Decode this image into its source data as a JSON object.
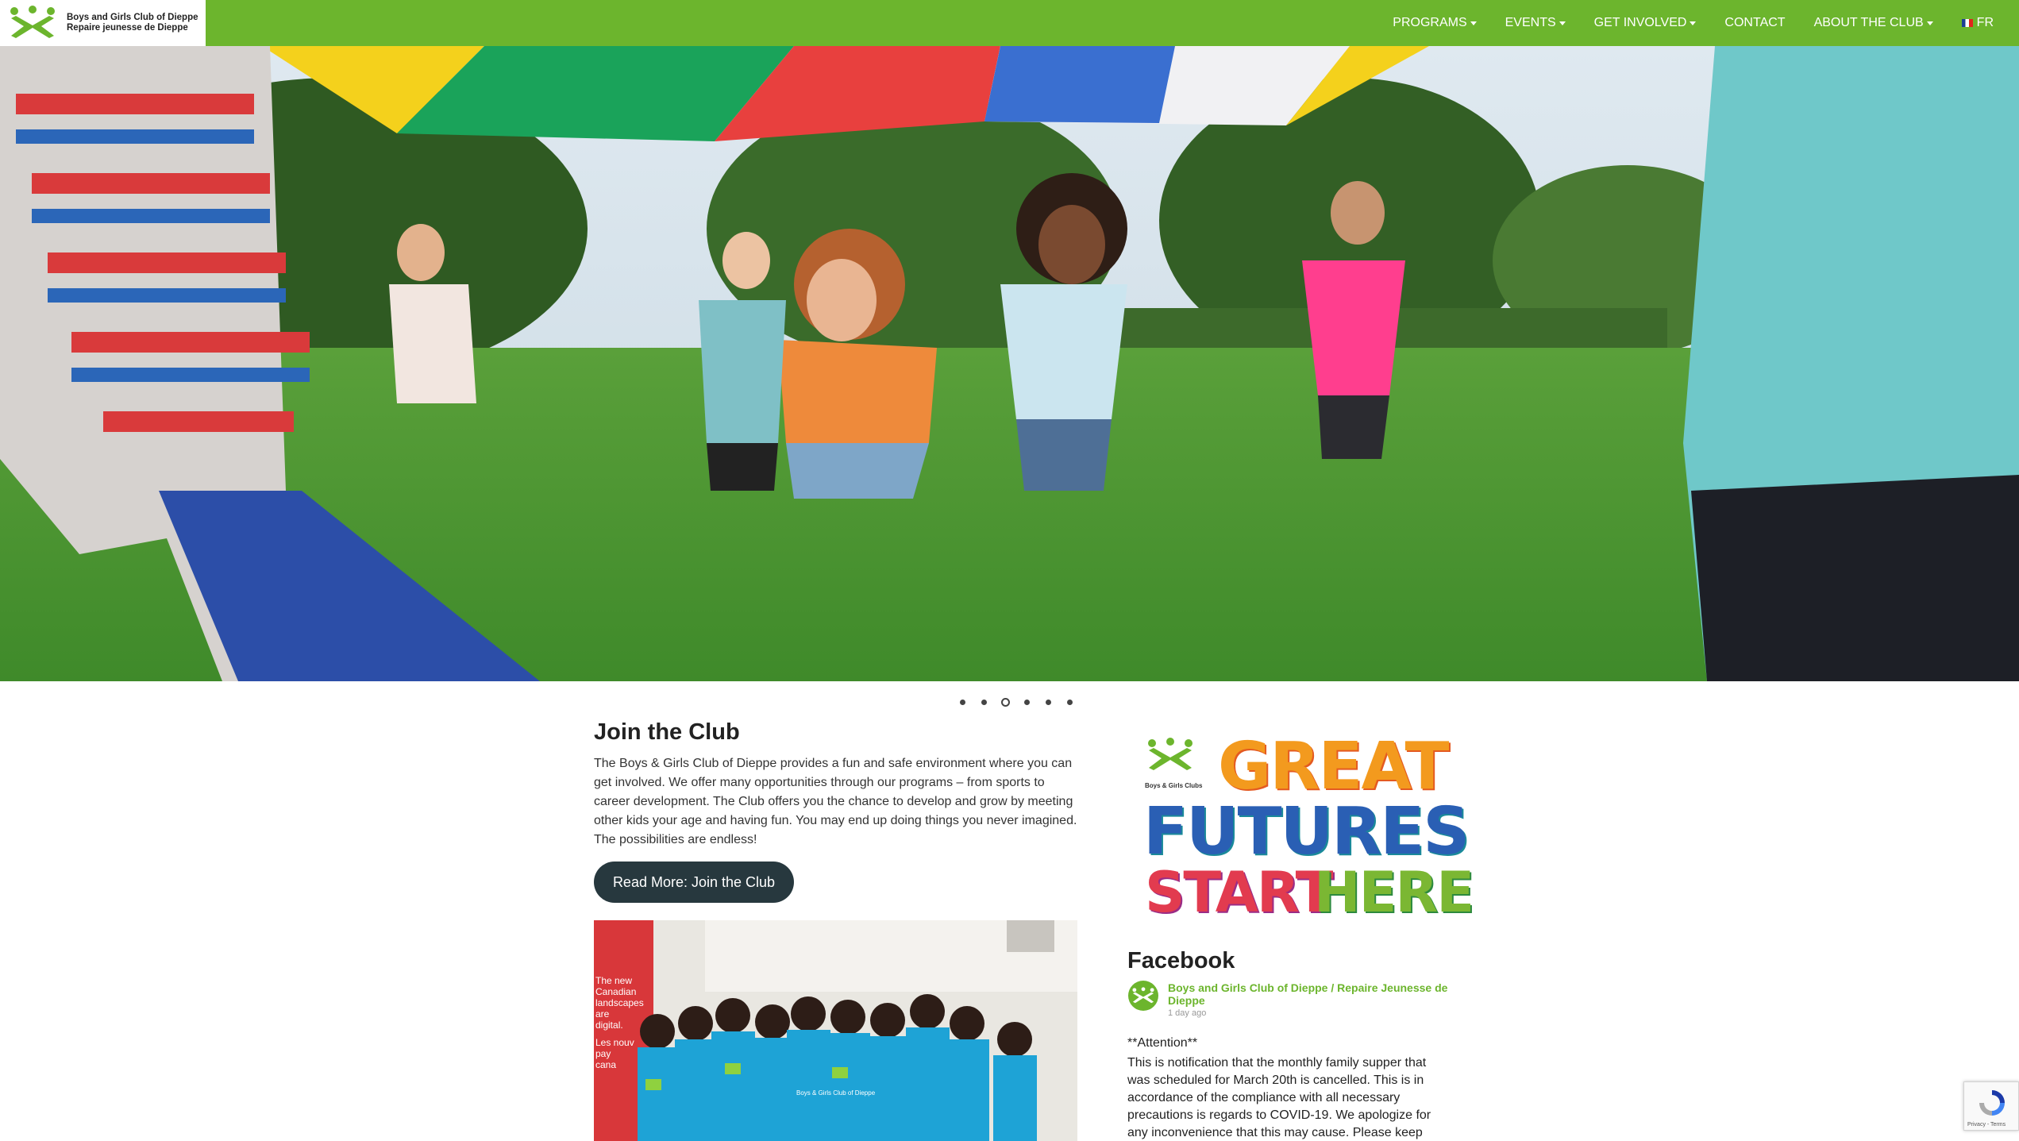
{
  "header": {
    "logo_line1": "Boys and Girls Club of Dieppe",
    "logo_line2": "Repaire jeunesse de Dieppe",
    "nav": [
      {
        "label": "PROGRAMS",
        "dropdown": true
      },
      {
        "label": "EVENTS",
        "dropdown": true
      },
      {
        "label": "GET INVOLVED",
        "dropdown": true
      },
      {
        "label": "CONTACT",
        "dropdown": false
      },
      {
        "label": "ABOUT THE CLUB",
        "dropdown": true
      }
    ],
    "language_label": "FR",
    "brand_color": "#6cb52d"
  },
  "carousel": {
    "slide_count": 6,
    "active_index": 2
  },
  "join": {
    "title": "Join the Club",
    "body": "The Boys & Girls Club of Dieppe provides a fun and safe environment where you can get involved.  We offer many opportunities through our programs – from sports to career development. The Club offers you the chance to develop and grow by meeting other kids your age and having fun. You may end up doing things you never imagined.  The possibilities are endless!",
    "button_label": "Read More:  Join the Club",
    "photo_banner_text": "The new Canadian landscapes are digital. Les nouv pay cana",
    "photo_shirt_text": "Boys & Girls Club of Dieppe"
  },
  "great_futures": {
    "org_label": "Boys & Girls Clubs",
    "line1": "GREAT",
    "line2": "FUTURES",
    "line3a": "START",
    "line3b": "HERE"
  },
  "facebook": {
    "title": "Facebook",
    "page_name": "Boys and Girls Club of Dieppe / Repaire Jeunesse de Dieppe",
    "time": "1 day ago",
    "attention": "**Attention**",
    "post": "This is notification that the monthly family supper that was scheduled for March 20th is cancelled. This is in accordance of the compliance with all necessary precautions is regards to COVID-19. We apologize for any inconvenience that this may cause. Please keep"
  },
  "recaptcha": {
    "text": "Privacy - Terms"
  }
}
